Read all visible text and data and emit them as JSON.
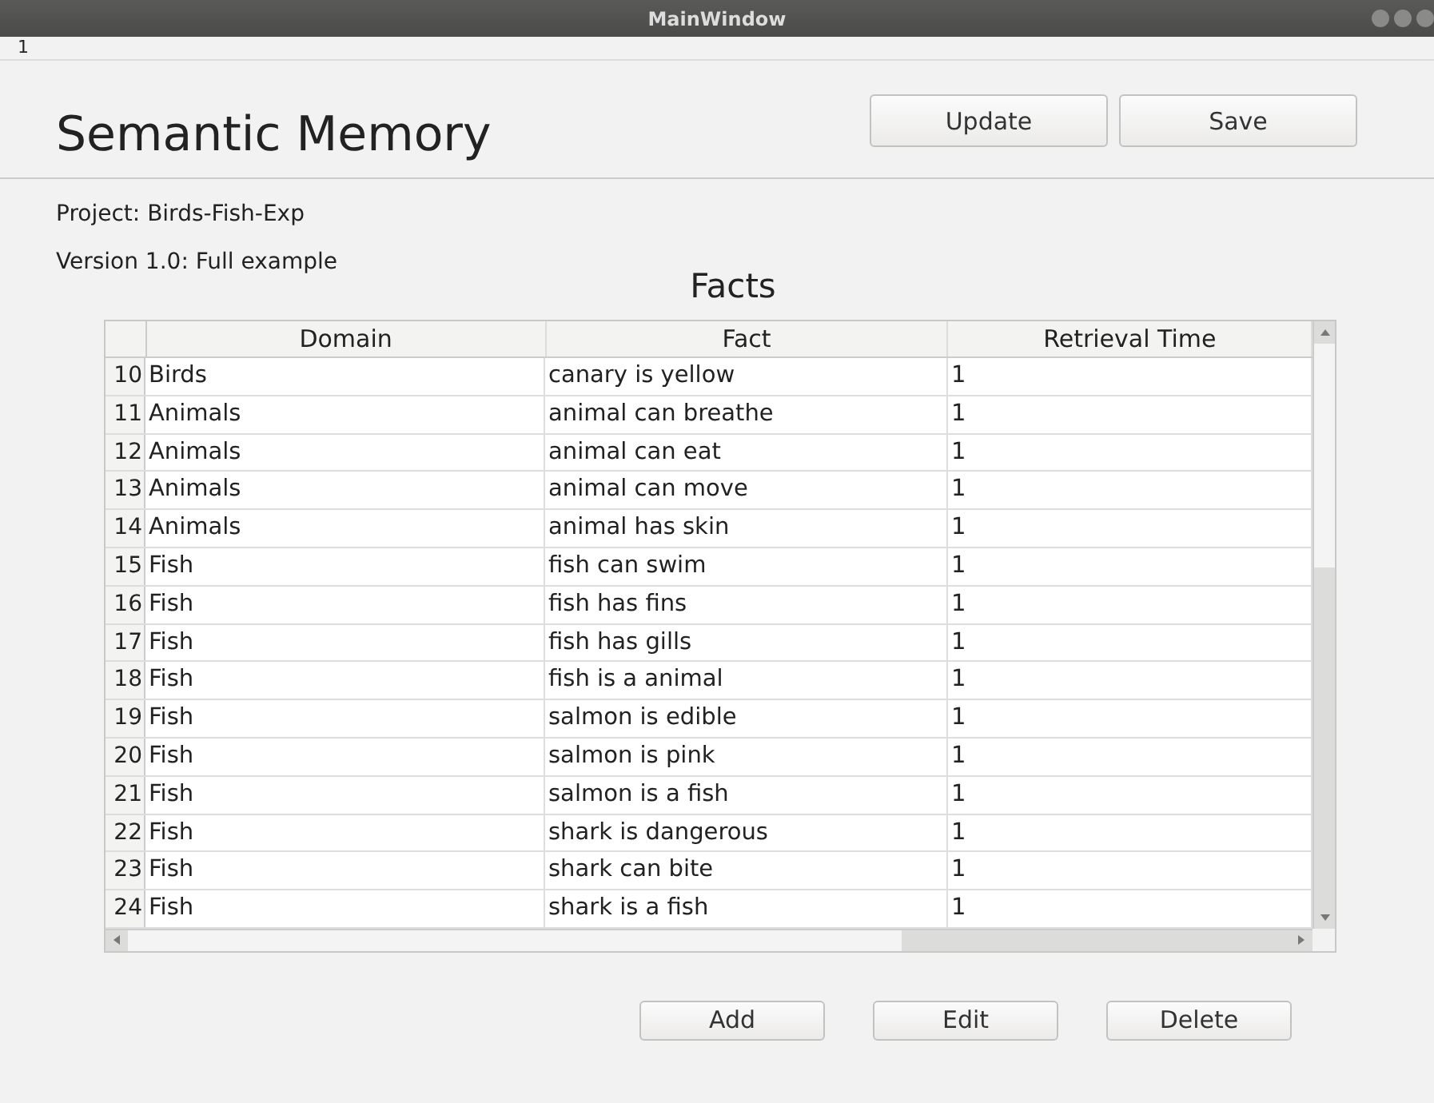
{
  "window": {
    "title": "MainWindow"
  },
  "menu_bar": {
    "item": "1"
  },
  "heading": "Semantic Memory",
  "top_buttons": [
    "Update",
    "Save"
  ],
  "project": "Project: Birds-Fish-Exp",
  "version": "Version 1.0: Full example",
  "section_title": "Facts",
  "table": {
    "columns": [
      "Domain",
      "Fact",
      "Retrieval Time"
    ],
    "rows": [
      {
        "number": "10",
        "cells": [
          "Birds",
          "canary is yellow",
          "1"
        ]
      },
      {
        "number": "11",
        "cells": [
          "Animals",
          "animal can breathe",
          "1"
        ]
      },
      {
        "number": "12",
        "cells": [
          "Animals",
          "animal can eat",
          "1"
        ]
      },
      {
        "number": "13",
        "cells": [
          "Animals",
          "animal can move",
          "1"
        ]
      },
      {
        "number": "14",
        "cells": [
          "Animals",
          "animal has skin",
          "1"
        ]
      },
      {
        "number": "15",
        "cells": [
          "Fish",
          "fish can swim",
          "1"
        ]
      },
      {
        "number": "16",
        "cells": [
          "Fish",
          "fish has fins",
          "1"
        ]
      },
      {
        "number": "17",
        "cells": [
          "Fish",
          "fish has gills",
          "1"
        ]
      },
      {
        "number": "18",
        "cells": [
          "Fish",
          "fish is a animal",
          "1"
        ]
      },
      {
        "number": "19",
        "cells": [
          "Fish",
          "salmon is edible",
          "1"
        ]
      },
      {
        "number": "20",
        "cells": [
          "Fish",
          "salmon is pink",
          "1"
        ]
      },
      {
        "number": "21",
        "cells": [
          "Fish",
          "salmon is a fish",
          "1"
        ]
      },
      {
        "number": "22",
        "cells": [
          "Fish",
          "shark is dangerous",
          "1"
        ]
      },
      {
        "number": "23",
        "cells": [
          "Fish",
          "shark can bite",
          "1"
        ]
      },
      {
        "number": "24",
        "cells": [
          "Fish",
          "shark is a fish",
          "1"
        ]
      }
    ]
  },
  "bottom_buttons": [
    "Add",
    "Edit",
    "Delete"
  ]
}
